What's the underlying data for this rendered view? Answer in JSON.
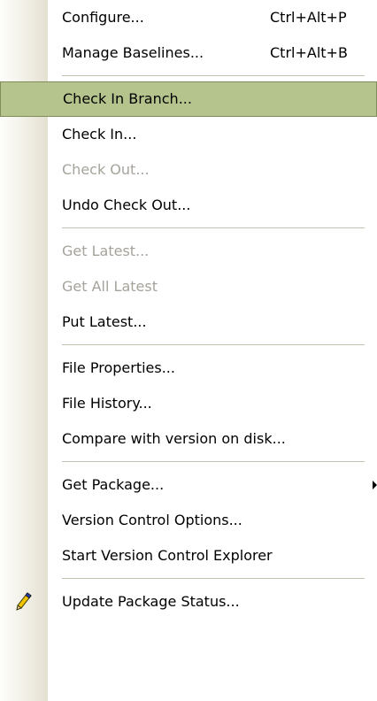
{
  "menu": {
    "items": [
      {
        "label": "Configure...",
        "shortcut": "Ctrl+Alt+P"
      },
      {
        "label": "Manage Baselines...",
        "shortcut": "Ctrl+Alt+B"
      },
      {
        "label": "Check In Branch...",
        "state": "highlighted"
      },
      {
        "label": "Check In..."
      },
      {
        "label": "Check Out...",
        "state": "disabled"
      },
      {
        "label": "Undo Check Out..."
      },
      {
        "label": "Get Latest...",
        "state": "disabled"
      },
      {
        "label": "Get All Latest",
        "state": "disabled"
      },
      {
        "label": "Put Latest..."
      },
      {
        "label": "File Properties..."
      },
      {
        "label": "File History..."
      },
      {
        "label": "Compare with version on disk..."
      },
      {
        "label": "Get Package...",
        "submenu": true
      },
      {
        "label": "Version Control Options..."
      },
      {
        "label": "Start Version Control Explorer"
      },
      {
        "label": "Update Package Status...",
        "icon": "pencil-icon"
      }
    ]
  },
  "colors": {
    "highlight": "#b5c48c",
    "highlight_border": "#7f8e5a",
    "disabled_text": "#a5a39a",
    "separator": "#c5c2b2"
  }
}
